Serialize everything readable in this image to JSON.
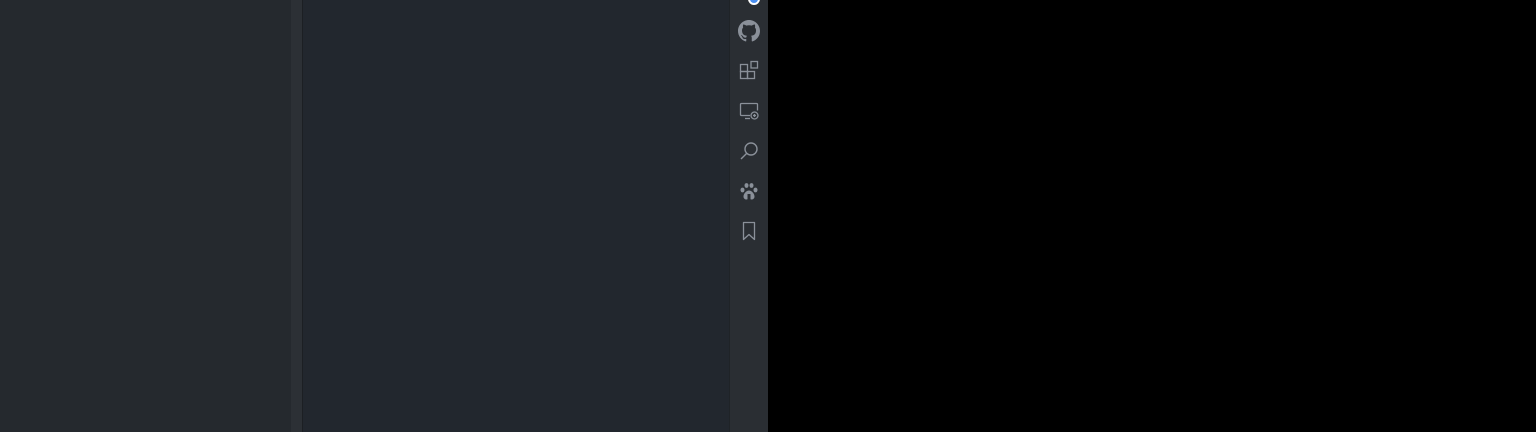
{
  "colors": {
    "sidebar_bg": "#25292e",
    "editor_bg": "#22272e",
    "activity_bar_bg": "#2a2e33",
    "icon_color": "#8a9099",
    "badge_color": "#4a8ff0",
    "outside_bg": "#000000"
  },
  "activity_bar": {
    "items": [
      {
        "icon": "github-icon"
      },
      {
        "icon": "extensions-icon"
      },
      {
        "icon": "remote-explorer-icon"
      },
      {
        "icon": "search-icon"
      },
      {
        "icon": "paw-icon"
      },
      {
        "icon": "bookmark-icon"
      }
    ]
  }
}
